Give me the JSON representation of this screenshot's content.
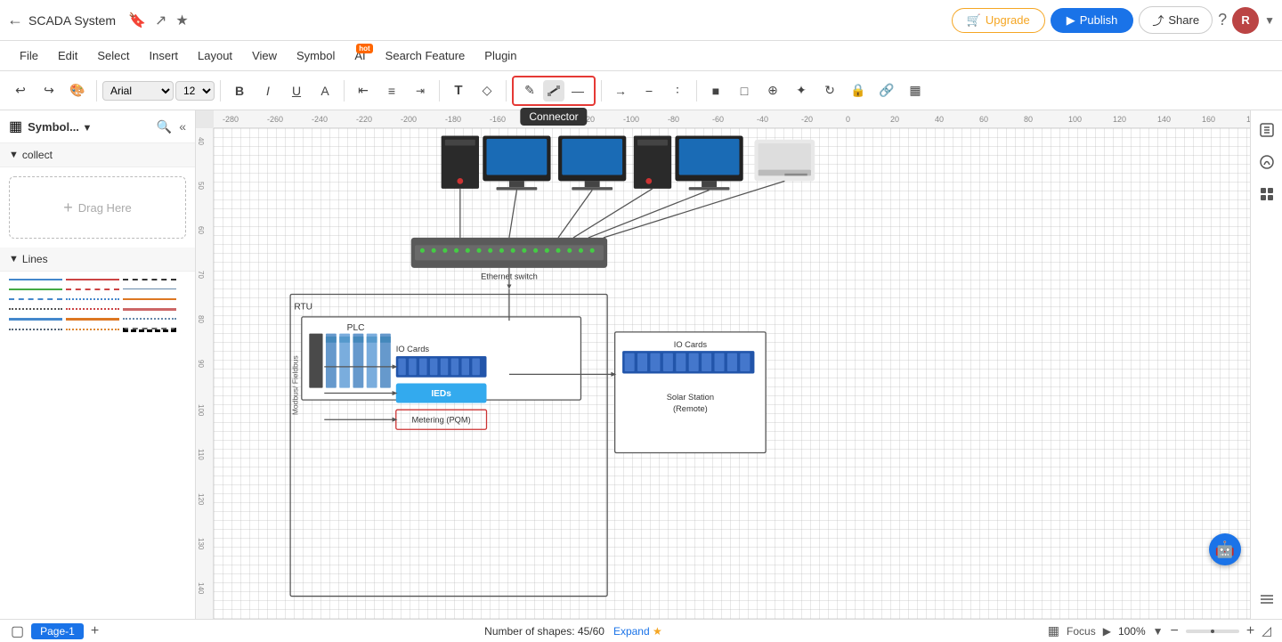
{
  "app": {
    "title": "SCADA System",
    "back_icon": "←",
    "bookmark_icon": "🔖",
    "share_icon": "↗",
    "star_icon": "☆"
  },
  "topbar": {
    "upgrade_label": "Upgrade",
    "publish_label": "Publish",
    "share_label": "Share",
    "help_icon": "?",
    "avatar_letter": "R"
  },
  "menubar": {
    "items": [
      "File",
      "Edit",
      "Select",
      "Insert",
      "Layout",
      "View",
      "Symbol",
      "AI",
      "Search Feature",
      "Plugin"
    ],
    "ai_badge": "hot"
  },
  "toolbar": {
    "font_family": "Arial",
    "font_size": "12",
    "undo_icon": "↩",
    "redo_icon": "↪",
    "paint_icon": "🖌",
    "bold_label": "B",
    "italic_label": "I",
    "underline_label": "U",
    "font_color_icon": "A",
    "align_left": "≡",
    "align_center": "≡",
    "align_right": "≡",
    "text_icon": "T",
    "shape_icon": "◇",
    "connector_label": "Connector",
    "line_icon": "—"
  },
  "left_panel": {
    "title": "Symbol...",
    "search_icon": "🔍",
    "collapse_icon": "«",
    "expand_icon": "▸",
    "collect_section": "collect",
    "drag_placeholder": "Drag Here",
    "lines_section": "Lines",
    "line_rows": [
      [
        "solid-blue",
        "dashed-red",
        "dotted-dark"
      ],
      [
        "solid-green",
        "dash-red2",
        "solid-thin2"
      ],
      [
        "dash-blue2",
        "dot-blue",
        "solid-orange"
      ],
      [
        "long-dash",
        "dot-red",
        "wave-red"
      ],
      [
        "wave-blue",
        "wave-orange",
        "dot-dark-long"
      ],
      [
        "dot-dark2",
        "dot-orange",
        "extra"
      ]
    ]
  },
  "diagram": {
    "ethernet_switch_label": "Ethernet switch",
    "rtu_label": "RTU",
    "plc_label": "PLC",
    "io_cards_label": "IO Cards",
    "io_cards_remote_label": "IO Cards",
    "solar_station_label": "Solar Station\n(Remote)",
    "ieds_label": "IEDs",
    "metering_label": "Metering (PQM)",
    "modbus_label": "Modbus/ Fieldbus"
  },
  "statusbar": {
    "page_label": "Page-1",
    "shapes_text": "Number of shapes: 45/60",
    "expand_label": "Expand",
    "focus_label": "Focus",
    "zoom_level": "100%",
    "page_tab": "Page-1",
    "add_page": "+"
  }
}
